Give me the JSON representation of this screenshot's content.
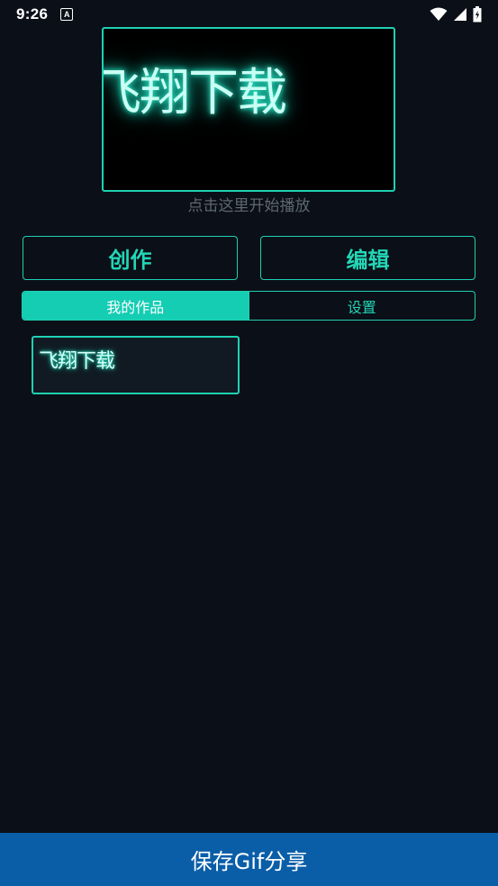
{
  "status_bar": {
    "time": "9:26",
    "notification_icon_letter": "A",
    "icons": [
      "wifi-icon",
      "signal-icon",
      "battery-icon"
    ]
  },
  "preview": {
    "text": "飞翔下载"
  },
  "hint": "点击这里开始播放",
  "buttons": {
    "create": "创作",
    "edit": "编辑"
  },
  "tabs": [
    {
      "label": "我的作品",
      "active": true
    },
    {
      "label": "设置",
      "active": false
    }
  ],
  "works": [
    {
      "text": "飞翔下载"
    }
  ],
  "save_button": "保存Gif分享",
  "colors": {
    "background": "#0b0f17",
    "accent": "#1fd1b3",
    "save_bar": "#0a5ea8"
  }
}
